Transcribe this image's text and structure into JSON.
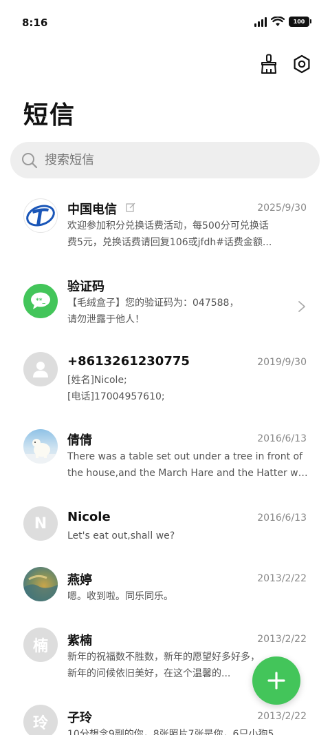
{
  "status_bar": {
    "time": "8:16",
    "battery": "100"
  },
  "header": {
    "title": "短信"
  },
  "search": {
    "placeholder": "搜索短信"
  },
  "conversations": [
    {
      "name": "中国电信",
      "date": "2025/9/30",
      "line1": "欢迎参加积分兑换话费活动，每500分可兑换话",
      "line2": "费5元，兑换话费请回复106或jfdh#话费金额...",
      "avatar": "china-telecom-logo"
    },
    {
      "name": "验证码",
      "date": "",
      "line1": "【毛绒盒子】您的验证码为：047588，",
      "line2": "请勿泄露于他人！",
      "avatar": "message-bubble"
    },
    {
      "name": "+8613261230775",
      "date": "2019/9/30",
      "line1": "[姓名]Nicole;",
      "line2": "[电话]17004957610;",
      "avatar": "person-placeholder"
    },
    {
      "name": "倩倩",
      "date": "2016/6/13",
      "line1": "There was a table set out under a tree in front of",
      "line2": "the house,and the March Hare and the Hatter wer...",
      "avatar": "polar-bear-photo"
    },
    {
      "name": "Nicole",
      "date": "2016/6/13",
      "line1": "Let's eat out,shall we?",
      "line2": "",
      "avatar_letter": "N"
    },
    {
      "name": "燕婷",
      "date": "2013/2/22",
      "line1": "嗯。收到啦。同乐同乐。",
      "line2": "",
      "avatar": "landscape-photo"
    },
    {
      "name": "紫楠",
      "date": "2013/2/22",
      "line1": "新年的祝福数不胜数，新年的愿望好多好多，",
      "line2": "新年的问候依旧美好，在这个温馨的...",
      "avatar_letter": "楠"
    },
    {
      "name": "子玲",
      "date": "2013/2/22",
      "line1": "10分想念9副的你，8张照片7张是你，6只小狗5...",
      "line2": "",
      "avatar_letter": "玲"
    }
  ],
  "colors": {
    "accent_green": "#43c55a",
    "telecom_blue": "#1a56b8"
  }
}
